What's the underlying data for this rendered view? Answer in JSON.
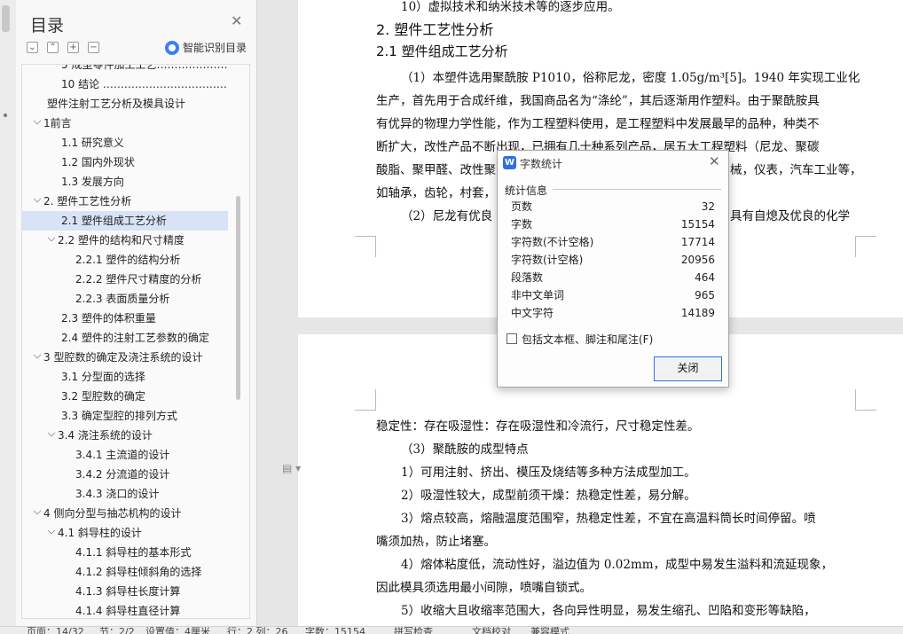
{
  "nav": {
    "title": "目录",
    "smart_toc": "智能识别目录",
    "toc": [
      {
        "label": "5  成型零件加工工艺……………………",
        "level": 1,
        "caret": false
      },
      {
        "label": "10   结论   ………………………………",
        "level": 1,
        "caret": false
      },
      {
        "label": "塑件注射工艺分析及模具设计",
        "level": 0,
        "caret": false
      },
      {
        "label": "1前言",
        "level": 0,
        "caret": true
      },
      {
        "label": "1.1   研究意义",
        "level": 1,
        "caret": false
      },
      {
        "label": "1.2   国内外现状",
        "level": 1,
        "caret": false
      },
      {
        "label": "1.3  发展方向",
        "level": 1,
        "caret": false
      },
      {
        "label": "2.  塑件工艺性分析",
        "level": 0,
        "caret": true
      },
      {
        "label": "2.1   塑件组成工艺分析",
        "level": 1,
        "caret": false
      },
      {
        "label": "2.2   塑件的结构和尺寸精度",
        "level": 1,
        "caret": true
      },
      {
        "label": "2.2.1   塑件的结构分析",
        "level": 2,
        "caret": false
      },
      {
        "label": "2.2.2   塑件尺寸精度的分析",
        "level": 2,
        "caret": false
      },
      {
        "label": "2.2.3   表面质量分析",
        "level": 2,
        "caret": false
      },
      {
        "label": "2.3   塑件的体积重量",
        "level": 1,
        "caret": false
      },
      {
        "label": "2.4   塑件的注射工艺参数的确定",
        "level": 1,
        "caret": false
      },
      {
        "label": "3   型腔数的确定及浇注系统的设计",
        "level": 0,
        "caret": true
      },
      {
        "label": "3.1   分型面的选择",
        "level": 1,
        "caret": false
      },
      {
        "label": "3.2   型腔数的确定",
        "level": 1,
        "caret": false
      },
      {
        "label": "3.3   确定型腔的排列方式",
        "level": 1,
        "caret": false
      },
      {
        "label": "3.4   浇注系统的设计",
        "level": 1,
        "caret": true
      },
      {
        "label": "3.4.1   主流道的设计",
        "level": 2,
        "caret": false
      },
      {
        "label": "3.4.2   分流道的设计",
        "level": 2,
        "caret": false
      },
      {
        "label": "3.4.3   浇口的设计",
        "level": 2,
        "caret": false
      },
      {
        "label": "4   侧向分型与抽芯机构的设计",
        "level": 0,
        "caret": true
      },
      {
        "label": "4.1   斜导柱的设计",
        "level": 1,
        "caret": true
      },
      {
        "label": "4.1.1   斜导柱的基本形式",
        "level": 2,
        "caret": false
      },
      {
        "label": "4.1.2   斜导柱倾斜角的选择",
        "level": 2,
        "caret": false
      },
      {
        "label": "4.1.3   斜导柱长度计算",
        "level": 2,
        "caret": false
      },
      {
        "label": "4.1.4   斜导柱直径计算",
        "level": 2,
        "caret": false
      }
    ],
    "active_index": 8
  },
  "doc": {
    "top_line": "10）虚拟技术和纳米技术等的逐步应用。",
    "h2": "2.   塑件工艺性分析",
    "h3": "2.1   塑件组成工艺分析",
    "p1": [
      "（1）本塑件选用聚酰胺 P1010，俗称尼龙，密度 1.05g/m³[5]。1940 年实现工业化",
      "生产，首先用于合成纤维，我国商品名为“涤纶”，其后逐渐用作塑料。由于聚酰胺具",
      "有优异的物理力学性能，作为工程塑料使用，是工程塑料中发展最早的品种，种类不",
      "断扩大，改性产品不断出现，已拥有几十种系列产品，居五大工程塑料（尼龙、聚碳",
      "酸脂、聚甲醛、改性聚",
      "如轴承，齿轮，村套，"
    ],
    "p1_right": [
      "械，仪表，汽车工业等，"
    ],
    "p2": "（2）尼龙有优良",
    "p2_right": "具有自熄及优良的化学",
    "page2": [
      "稳定性：存在吸湿性：存在吸湿性和冷流行，尺寸稳定性差。",
      "（3）聚酰胺的成型特点",
      "1）可用注射、挤出、模压及烧结等多种方法成型加工。",
      "2）吸湿性较大，成型前须干燥：热稳定性差，易分解。",
      "3）熔点较高，熔融温度范围窄，热稳定性差，不宜在高温料筒长时间停留。喷",
      "嘴须加热，防止堵塞。",
      "4）熔体粘度低，流动性好，溢边值为 0.02mm，成型中易发生溢料和流延现象，",
      "因此模具须选用最小间隙，喷嘴自锁式。",
      "5）收缩大且收缩率范围大，各向异性明显，易发生缩孔、凹陷和变形等缺陷，"
    ]
  },
  "dialog": {
    "title": "字数统计",
    "group": "统计信息",
    "stats": [
      {
        "label": "页数",
        "value": "32"
      },
      {
        "label": "字数",
        "value": "15154"
      },
      {
        "label": "字符数(不计空格)",
        "value": "17714"
      },
      {
        "label": "字符数(计空格)",
        "value": "20956"
      },
      {
        "label": "段落数",
        "value": "464"
      },
      {
        "label": "非中文单词",
        "value": "965"
      },
      {
        "label": "中文字符",
        "value": "14189"
      }
    ],
    "include_label": "包括文本框、脚注和尾注(F)",
    "close_label": "关闭"
  },
  "status": {
    "page": "页面：14/32",
    "section": "节：2/2",
    "setting": "设置值：4厘米",
    "row_col": "行：2  列：26",
    "word_count": "字数：15154",
    "spell": "拼写检查",
    "proof": "文档校对",
    "compat": "兼容模式"
  }
}
